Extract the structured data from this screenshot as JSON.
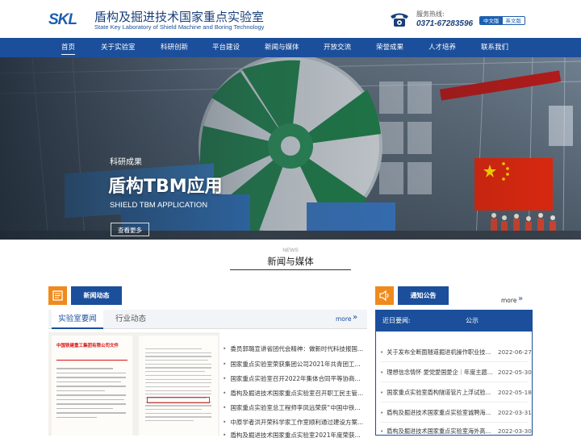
{
  "header": {
    "logo_text": "SKL",
    "title_cn": "盾构及掘进技术国家重点实验室",
    "title_en": "State Key Laboratory of Shield Machine and Boring Technology",
    "hotline_label": "服务热线:",
    "hotline_number": "0371-67283596",
    "lang_zh": "中文版",
    "lang_en": "英文版"
  },
  "nav": {
    "items": [
      {
        "label": "首页"
      },
      {
        "label": "关于实验室"
      },
      {
        "label": "科研创新"
      },
      {
        "label": "平台建设"
      },
      {
        "label": "新闻与媒体"
      },
      {
        "label": "开放交流"
      },
      {
        "label": "荣誉成果"
      },
      {
        "label": "人才培养"
      },
      {
        "label": "联系我们"
      }
    ]
  },
  "banner": {
    "subtitle": "科研成果",
    "title": "盾构TBM应用",
    "title_en": "SHIELD TBM APPLICATION",
    "button": "查看更多"
  },
  "section": {
    "en": "NEWS",
    "cn": "新闻与媒体"
  },
  "news": {
    "tab": "新闻动态",
    "subtab_active": "实验室要闻",
    "subtab_other": "行业动态",
    "more": "more",
    "doc_title": "中国铁建重工集团有限公司文件",
    "items": [
      "委员郭璐宣讲省团代会精神：做新时代科技报国...",
      "国家重点实验室荣获集团公司2021年共青团工...",
      "国家重点实验室召开2022年集体合同平等协商...",
      "盾构及掘进技术国家重点实验室召开职工民主管...",
      "国家重点实验室总工程师李凤远荣获“中国中铁...",
      "中原学者洪开荣科学家工作室顺利通过建设方案...",
      "盾构及掘进技术国家重点实验室2021年度荣获..."
    ]
  },
  "notice": {
    "tab": "通知公告",
    "more": "more",
    "head_a": "近日要闻:",
    "head_b": "公示",
    "items": [
      {
        "title": "关于发布全断面隧道掘进机操作职业技...",
        "date": "2022-06-27"
      },
      {
        "title": "理想信念情怀 愛党愛国愛企｜年度主题...",
        "date": "2022-05-30"
      },
      {
        "title": "国家重点实验室盾构隧道管片上浮试验...",
        "date": "2022-05-18"
      },
      {
        "title": "盾构及掘进技术国家重点实验室诚聘海...",
        "date": "2022-03-31"
      },
      {
        "title": "盾构及掘进技术国家重点实验室海外高...",
        "date": "2022-03-30"
      }
    ]
  },
  "colors": {
    "primary": "#1b4f9b",
    "accent": "#f08a1c"
  }
}
